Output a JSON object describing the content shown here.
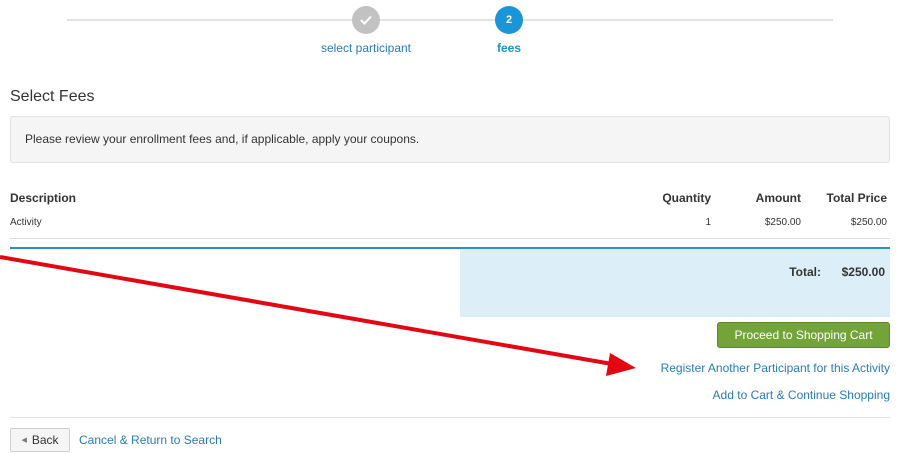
{
  "stepper": {
    "steps": [
      {
        "number": "",
        "label": "select participant",
        "state": "complete"
      },
      {
        "number": "2",
        "label": "fees",
        "state": "active"
      }
    ]
  },
  "page_title": "Select Fees",
  "notice": "Please review your enrollment fees and, if applicable, apply your coupons.",
  "fees_table": {
    "headers": {
      "description": "Description",
      "quantity": "Quantity",
      "amount": "Amount",
      "total_price": "Total Price"
    },
    "rows": [
      {
        "description": "Activity",
        "quantity": "1",
        "amount": "$250.00",
        "total_price": "$250.00"
      }
    ]
  },
  "totals": {
    "label": "Total:",
    "value": "$250.00"
  },
  "actions": {
    "proceed_label": "Proceed to Shopping Cart",
    "register_another_label": "Register Another Participant for this Activity",
    "add_to_cart_label": "Add to Cart & Continue Shopping"
  },
  "footer": {
    "back_label": "Back",
    "cancel_label": "Cancel & Return to Search"
  },
  "colors": {
    "accent": "#1a95d7",
    "link": "#2a7ab8",
    "proceed_button": "#72a43a",
    "total_background": "#dceff8",
    "annotation_arrow": "#e30613"
  },
  "icons": {
    "completed_step": "checkmark-icon",
    "back": "triangle-left-icon",
    "annotation": "red-arrow"
  }
}
